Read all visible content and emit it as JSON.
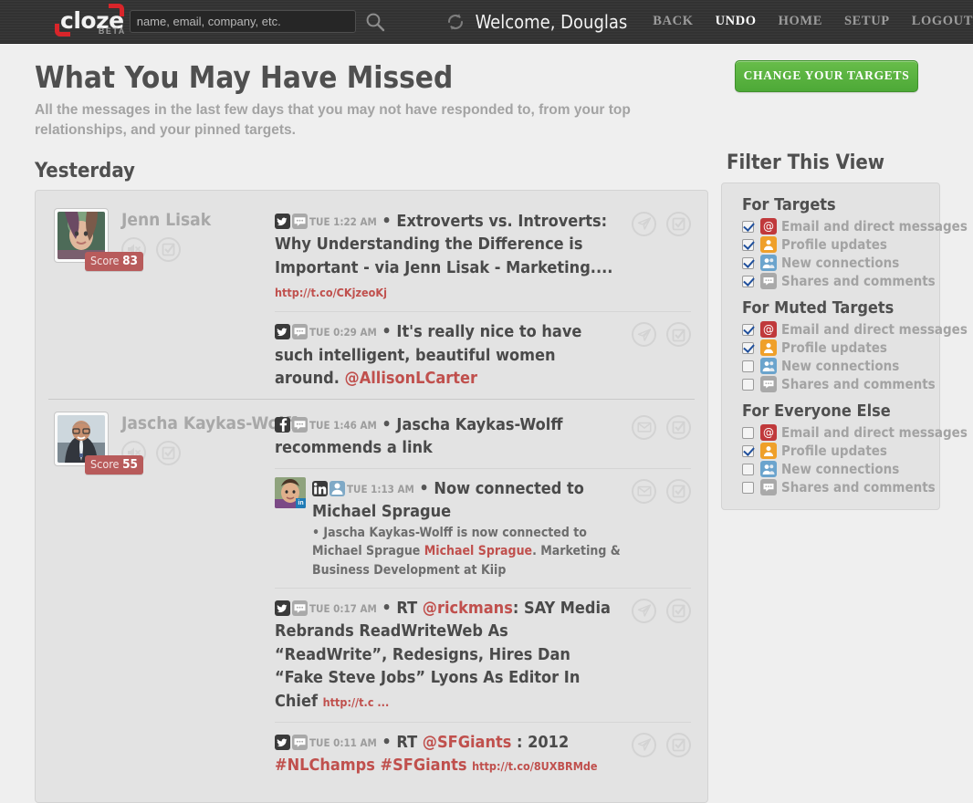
{
  "header": {
    "logo": "cloze",
    "logo_beta": "BETA",
    "search_placeholder": "name, email, company, etc.",
    "search_value": "",
    "welcome": "Welcome, Douglas",
    "nav": [
      {
        "label": "BACK",
        "active": false
      },
      {
        "label": "UNDO",
        "active": true
      },
      {
        "label": "HOME",
        "active": false
      },
      {
        "label": "SETUP",
        "active": false
      },
      {
        "label": "LOGOUT",
        "active": false
      }
    ]
  },
  "main": {
    "title": "What You May Have Missed",
    "subtitle": "All the messages in the last few days that you may not have responded to, from your top relationships, and your pinned targets.",
    "day_group": "Yesterday"
  },
  "sidebar": {
    "change_targets_button": "CHANGE YOUR TARGETS",
    "filter_title": "Filter This View",
    "groups": [
      {
        "name": "For Targets",
        "rows": [
          {
            "label": "Email and direct messages",
            "icon": "at-icon",
            "checked": true
          },
          {
            "label": "Profile updates",
            "icon": "profile-icon",
            "checked": true
          },
          {
            "label": "New connections",
            "icon": "connections-icon",
            "checked": true
          },
          {
            "label": "Shares and comments",
            "icon": "chat-icon",
            "checked": true
          }
        ]
      },
      {
        "name": "For Muted Targets",
        "rows": [
          {
            "label": "Email and direct messages",
            "icon": "at-icon",
            "checked": true
          },
          {
            "label": "Profile updates",
            "icon": "profile-icon",
            "checked": true
          },
          {
            "label": "New connections",
            "icon": "connections-icon",
            "checked": false
          },
          {
            "label": "Shares and comments",
            "icon": "chat-icon",
            "checked": false
          }
        ]
      },
      {
        "name": "For Everyone Else",
        "rows": [
          {
            "label": "Email and direct messages",
            "icon": "at-icon",
            "checked": false
          },
          {
            "label": "Profile updates",
            "icon": "profile-icon",
            "checked": true
          },
          {
            "label": "New connections",
            "icon": "connections-icon",
            "checked": false
          },
          {
            "label": "Shares and comments",
            "icon": "chat-icon",
            "checked": false
          }
        ]
      }
    ]
  },
  "feed": [
    {
      "name": "Jenn Lisak",
      "score_label": "Score",
      "score": "83",
      "messages": [
        {
          "source": "twitter",
          "second_badge": "chat",
          "timestamp": "TUE 1:22 AM",
          "text": "Extroverts vs. Introverts: Why Understanding the Difference is Important - via Jenn Lisak - Marketing....",
          "url": "http://t.co/CKjzeoKj",
          "action_primary": "send-icon"
        },
        {
          "source": "twitter",
          "second_badge": "chat",
          "timestamp": "TUE 0:29 AM",
          "text": "It's really nice to have such intelligent, beautiful women around.",
          "mention": "@AllisonLCarter",
          "action_primary": "send-icon"
        }
      ]
    },
    {
      "name": "Jascha Kaykas-Wolff",
      "score_label": "Score",
      "score": "55",
      "messages": [
        {
          "source": "facebook",
          "second_badge": "chat",
          "timestamp": "TUE 1:46 AM",
          "text": "Jascha Kaykas-Wolff recommends a link",
          "action_primary": "mail-icon"
        },
        {
          "source": "linkedin",
          "second_badge": "person",
          "has_thumb": true,
          "timestamp": "TUE 1:13 AM",
          "text": "Now connected to Michael Sprague",
          "sub_prefix": "• Jascha Kaykas-Wolff is now connected to Michael Sprague ",
          "sub_link": "Michael Sprague",
          "sub_suffix": ". Marketing & Business Development at Kiip",
          "action_primary": "mail-icon"
        },
        {
          "source": "twitter",
          "second_badge": "chat",
          "timestamp": "TUE 0:17 AM",
          "rt": "RT ",
          "mention": "@rickmans",
          "text": ": SAY Media Rebrands ReadWriteWeb As “ReadWrite”, Redesigns, Hires Dan “Fake Steve Jobs” Lyons As Editor In Chief",
          "url": "http://t.c ...",
          "action_primary": "send-icon"
        },
        {
          "source": "twitter",
          "second_badge": "chat",
          "timestamp": "TUE 0:11 AM",
          "rt": "RT ",
          "mention": "@SFGiants",
          "text": " : 2012 ",
          "hashtags": [
            "#NLChamps",
            "#SFGiants"
          ],
          "url": "http://t.co/8UXBRMde",
          "action_primary": "send-icon"
        }
      ]
    }
  ],
  "icons": {
    "search": "search-icon",
    "refresh": "refresh-icon",
    "mute": "mute-icon",
    "done": "check-square-icon",
    "send": "send-icon",
    "mail": "mail-icon"
  },
  "colors": {
    "accent_red": "#c0504d",
    "brand_red": "#d9252a",
    "green_button": "#4da937",
    "header_bg": "#343434",
    "page_bg": "#efefef",
    "card_bg": "#e3e3e3"
  }
}
